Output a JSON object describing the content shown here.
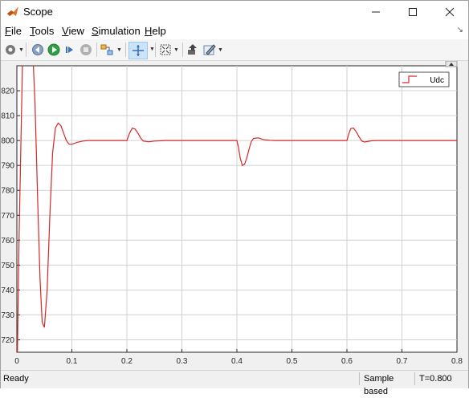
{
  "window": {
    "title": "Scope"
  },
  "menu": [
    {
      "label": "File",
      "key": "F",
      "rest": "ile"
    },
    {
      "label": "Tools",
      "key": "T",
      "rest": "ools"
    },
    {
      "label": "View",
      "key": "V",
      "rest": "iew"
    },
    {
      "label": "Simulation",
      "key": "S",
      "rest": "imulation"
    },
    {
      "label": "Help",
      "key": "H",
      "rest": "elp"
    }
  ],
  "toolbar": {
    "icons": [
      "settings-gear-icon",
      "step-back-icon",
      "run-icon",
      "step-forward-icon",
      "stop-icon",
      "highlight-block-icon",
      "zoom-cursor-icon",
      "fit-axes-icon",
      "restore-layout-icon",
      "style-icon"
    ]
  },
  "status": {
    "ready": "Ready",
    "mode": "Sample based",
    "time": "T=0.800"
  },
  "colors": {
    "trace": "#d62728",
    "axes_bg": "#ffffff",
    "grid": "#d0d0d0"
  },
  "chart_data": {
    "type": "line",
    "title": "",
    "xlabel": "",
    "ylabel": "",
    "xlim": [
      0,
      0.8
    ],
    "ylim": [
      715,
      830
    ],
    "xticks": [
      "0",
      "0.1",
      "0.2",
      "0.3",
      "0.4",
      "0.5",
      "0.6",
      "0.7",
      "0.8"
    ],
    "yticks": [
      "720",
      "730",
      "740",
      "750",
      "760",
      "770",
      "780",
      "790",
      "800",
      "810",
      "820"
    ],
    "grid": true,
    "legend": {
      "position": "top-right",
      "entries": [
        "Udc"
      ]
    },
    "series": [
      {
        "name": "Udc",
        "x": [
          0,
          0.004,
          0.01,
          0.016,
          0.022,
          0.028,
          0.033,
          0.038,
          0.042,
          0.046,
          0.05,
          0.055,
          0.06,
          0.065,
          0.07,
          0.075,
          0.08,
          0.085,
          0.09,
          0.095,
          0.1,
          0.11,
          0.12,
          0.13,
          0.15,
          0.17,
          0.19,
          0.2,
          0.205,
          0.21,
          0.215,
          0.22,
          0.225,
          0.23,
          0.24,
          0.25,
          0.27,
          0.3,
          0.35,
          0.4,
          0.403,
          0.406,
          0.41,
          0.414,
          0.418,
          0.422,
          0.426,
          0.43,
          0.435,
          0.44,
          0.445,
          0.45,
          0.46,
          0.47,
          0.48,
          0.5,
          0.55,
          0.6,
          0.603,
          0.607,
          0.612,
          0.617,
          0.622,
          0.627,
          0.632,
          0.637,
          0.645,
          0.655,
          0.67,
          0.7,
          0.75,
          0.8
        ],
        "y": [
          700,
          760,
          830,
          840,
          840,
          840,
          815,
          775,
          745,
          727,
          725,
          740,
          770,
          795,
          805,
          807,
          806,
          803,
          800,
          798.5,
          798.5,
          799.3,
          799.8,
          800,
          800,
          800,
          800,
          800,
          803,
          805,
          804.6,
          803,
          801,
          799.8,
          799.5,
          799.8,
          800,
          800,
          800,
          800,
          797,
          793,
          790,
          790.5,
          793,
          796.5,
          799.5,
          800.8,
          801,
          801,
          800.6,
          800.3,
          800.1,
          800,
          800,
          800,
          800,
          800,
          802.5,
          804.8,
          805,
          803.5,
          801.5,
          799.8,
          799.4,
          799.6,
          799.9,
          800,
          800,
          800,
          800,
          800
        ]
      }
    ]
  }
}
